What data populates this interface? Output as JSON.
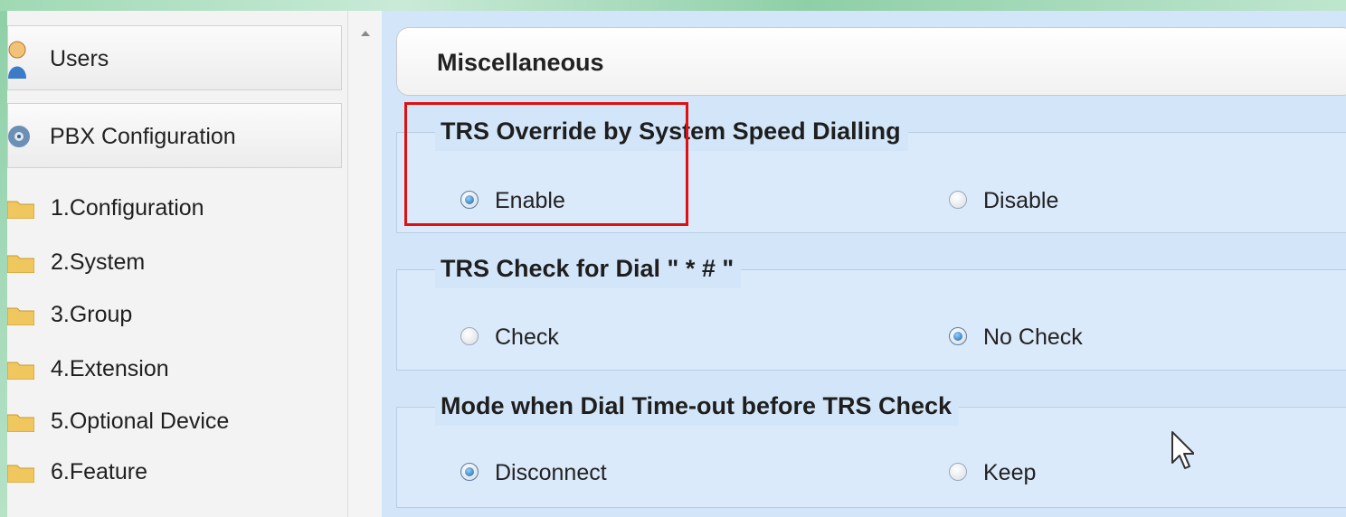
{
  "sidebar": {
    "headers": [
      {
        "label": "Users",
        "icon": "user-icon"
      },
      {
        "label": "PBX Configuration",
        "icon": "gear-icon"
      }
    ],
    "items": [
      {
        "label": "1.Configuration"
      },
      {
        "label": "2.System"
      },
      {
        "label": "3.Group"
      },
      {
        "label": "4.Extension"
      },
      {
        "label": "5.Optional Device"
      },
      {
        "label": "6.Feature"
      }
    ]
  },
  "main": {
    "title": "Miscellaneous",
    "sections": [
      {
        "legend": "TRS Override by System Speed Dialling",
        "options": [
          {
            "label": "Enable",
            "selected": true
          },
          {
            "label": "Disable",
            "selected": false
          }
        ]
      },
      {
        "legend": "TRS Check for Dial \" * # \"",
        "options": [
          {
            "label": "Check",
            "selected": false
          },
          {
            "label": "No Check",
            "selected": true
          }
        ]
      },
      {
        "legend": "Mode when Dial Time-out before TRS Check",
        "options": [
          {
            "label": "Disconnect",
            "selected": true
          },
          {
            "label": "Keep",
            "selected": false
          }
        ]
      }
    ]
  },
  "colors": {
    "highlight": "#e01010",
    "panel_bg": "#d3e6f9",
    "accent": "#1b62a8"
  }
}
